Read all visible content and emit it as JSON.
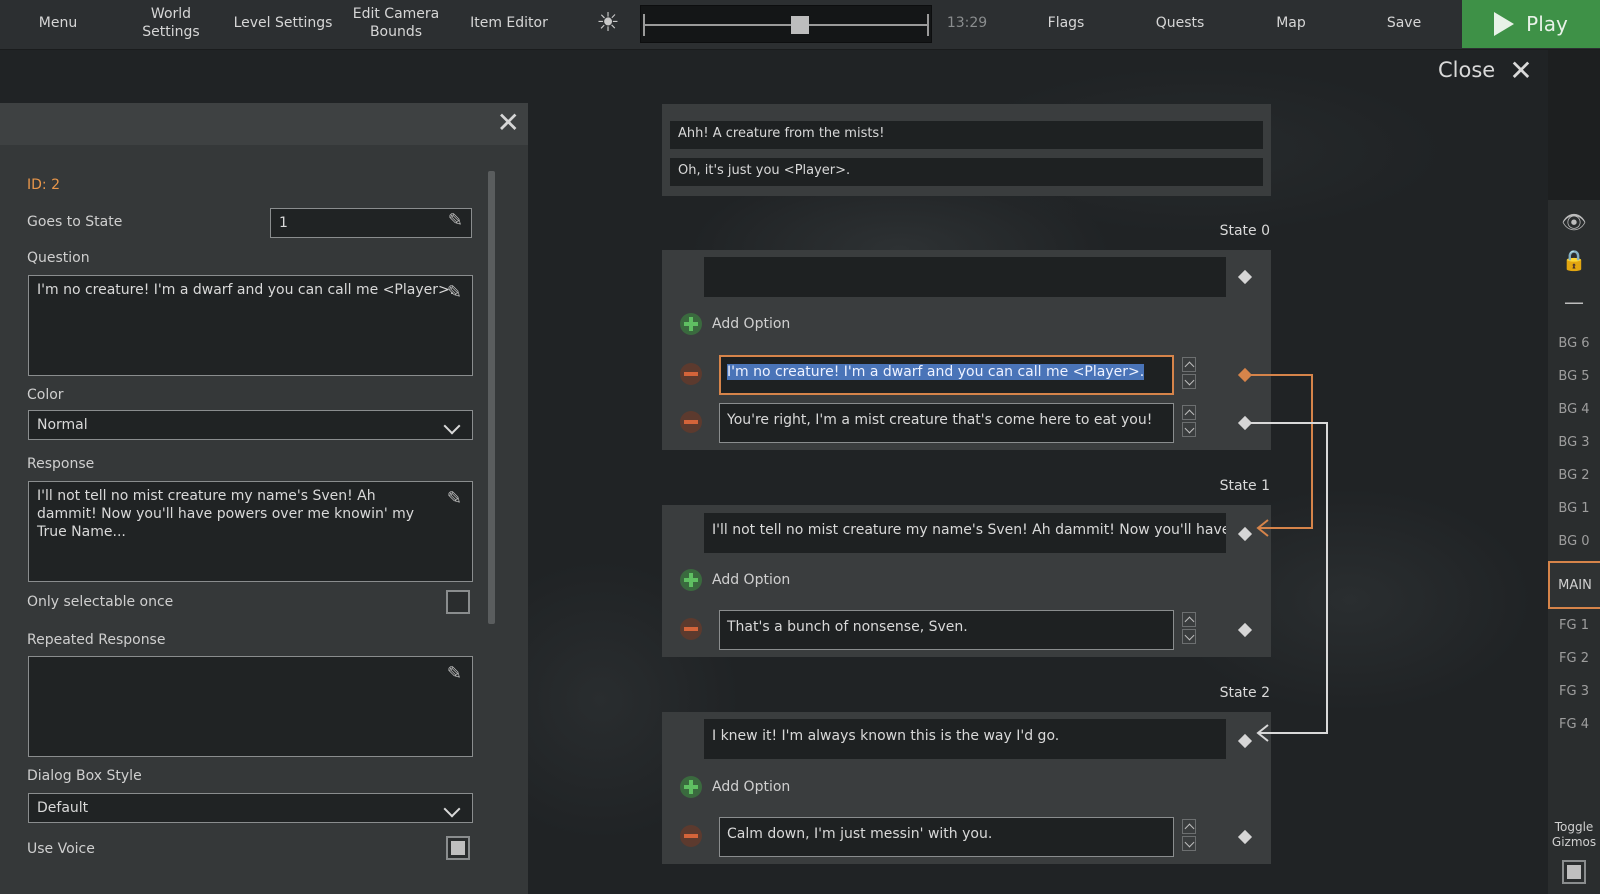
{
  "topbar": {
    "menu": "Menu",
    "world_settings": "World\nSettings",
    "level_settings": "Level Settings",
    "edit_camera_bounds": "Edit Camera\nBounds",
    "item_editor": "Item Editor",
    "time": "13:29",
    "flags": "Flags",
    "quests": "Quests",
    "map": "Map",
    "save": "Save",
    "play": "Play",
    "timeline_fraction": 0.55
  },
  "close_label": "Close",
  "left_panel": {
    "id_label": "ID: 2",
    "goes_to_state_label": "Goes to State",
    "goes_to_state_value": "1",
    "question_label": "Question",
    "question_value": "I'm no creature! I'm a dwarf and you can call me <Player>.",
    "color_label": "Color",
    "color_value": "Normal",
    "response_label": "Response",
    "response_value": "I'll not tell no mist creature my name's Sven! Ah dammit! Now you'll have powers over me knowin' my True Name...",
    "only_selectable_once_label": "Only selectable once",
    "only_selectable_once_checked": false,
    "repeated_response_label": "Repeated Response",
    "repeated_response_value": "",
    "dialog_box_style_label": "Dialog Box Style",
    "dialog_box_style_value": "Default",
    "use_voice_label": "Use Voice",
    "use_voice_checked": true
  },
  "dialog": {
    "intro_lines": [
      "Ahh! A creature from the mists!",
      "Oh, it's just you <Player>."
    ],
    "add_option_label": "Add Option",
    "states": [
      {
        "label": "State 0",
        "response": "",
        "options": [
          "I'm no creature! I'm a dwarf and you can call me <Player>.",
          "You're right, I'm a mist creature that's come here to eat you!"
        ]
      },
      {
        "label": "State 1",
        "response": "I'll not tell no mist creature my name's Sven! Ah dammit! Now you'll have power",
        "options": [
          "That's a bunch of nonsense, Sven."
        ]
      },
      {
        "label": "State 2",
        "response": "I knew it! I'm always known this is the way I'd go.",
        "options": [
          "Calm down, I'm just messin' with you."
        ]
      }
    ]
  },
  "layers": {
    "items": [
      "BG 6",
      "BG 5",
      "BG 4",
      "BG 3",
      "BG 2",
      "BG 1",
      "BG 0",
      "MAIN",
      "FG 1",
      "FG 2",
      "FG 3",
      "FG 4"
    ],
    "active": "MAIN",
    "toggle_gizmos_label": "Toggle\nGizmos"
  },
  "colors": {
    "accent_orange": "#d6844a",
    "play_green": "#3e9147",
    "add_green": "#5fbf62",
    "remove_orange": "#d4643a",
    "selection_blue": "#4a74b8"
  }
}
